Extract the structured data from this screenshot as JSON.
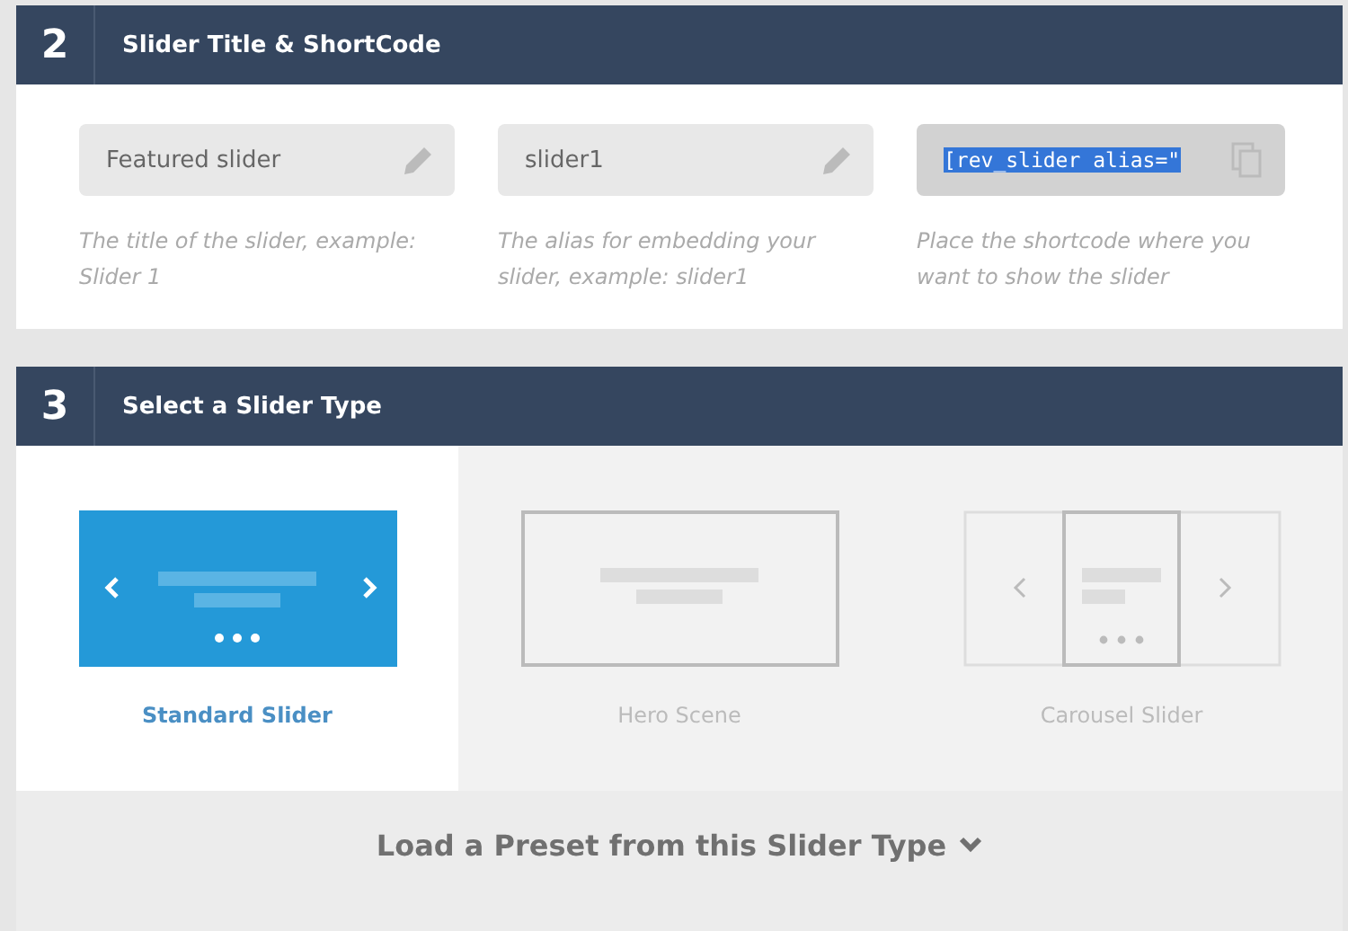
{
  "sections": [
    {
      "number": "2",
      "title": "Slider Title & ShortCode"
    },
    {
      "number": "3",
      "title": "Select a Slider Type"
    }
  ],
  "fields": [
    {
      "kind": "text",
      "value": "Featured slider",
      "hint": "The title of the slider, example: Slider 1"
    },
    {
      "kind": "text",
      "value": "slider1",
      "hint": "The alias for embedding your slider, example: slider1"
    },
    {
      "kind": "shortcode",
      "value": "[rev_slider alias=\"",
      "hint": "Place the shortcode where you want to show the slider"
    }
  ],
  "slider_types": [
    {
      "kind": "standard",
      "label": "Standard Slider",
      "selected": true
    },
    {
      "kind": "hero",
      "label": "Hero Scene",
      "selected": false
    },
    {
      "kind": "carousel",
      "label": "Carousel Slider",
      "selected": false
    }
  ],
  "preset": {
    "label": "Load a Preset from this Slider Type"
  }
}
